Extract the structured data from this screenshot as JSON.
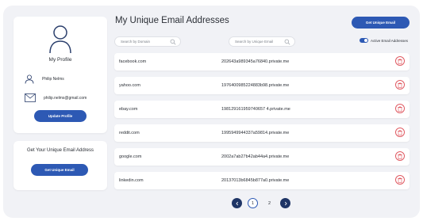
{
  "profile": {
    "title": "My Profile",
    "name": "Philip Nelms",
    "email": "philip.nelms@gmail.com",
    "update_label": "Update Profile"
  },
  "unique_card": {
    "title": "Get Your Unique Email Address",
    "button_label": "Get Unique Email"
  },
  "main": {
    "title": "My Unique Email Addresses",
    "top_button_label": "Get Unique Email",
    "search_domain_placeholder": "Search by Domain",
    "search_email_placeholder": "Search by Unique Email",
    "toggle_label": "Active Email Addresses",
    "toggle_on": true
  },
  "rows": [
    {
      "domain": "facebook.com",
      "email": "202643a989345a76840.private.me"
    },
    {
      "domain": "yahoo.com",
      "email": "1976400985224883b98.private.me"
    },
    {
      "domain": "ebay.com",
      "email": "198129161959740657 4.private.me"
    },
    {
      "domain": "reddit.com",
      "email": "1995949944337a59814.private.me"
    },
    {
      "domain": "google.com",
      "email": "2002a7ab27b42ab44a4.private.me"
    },
    {
      "domain": "linkedin.com",
      "email": "20137013b6845b877a0.private.me"
    }
  ],
  "pagination": {
    "pages": [
      "1",
      "2"
    ],
    "current": "1",
    "prev_icon": "chevron-left-icon",
    "next_icon": "chevron-right-icon"
  },
  "colors": {
    "accent": "#2d59b4",
    "delete": "#e05b63",
    "pager_dark": "#1f3566",
    "background": "#f1f2f6"
  }
}
